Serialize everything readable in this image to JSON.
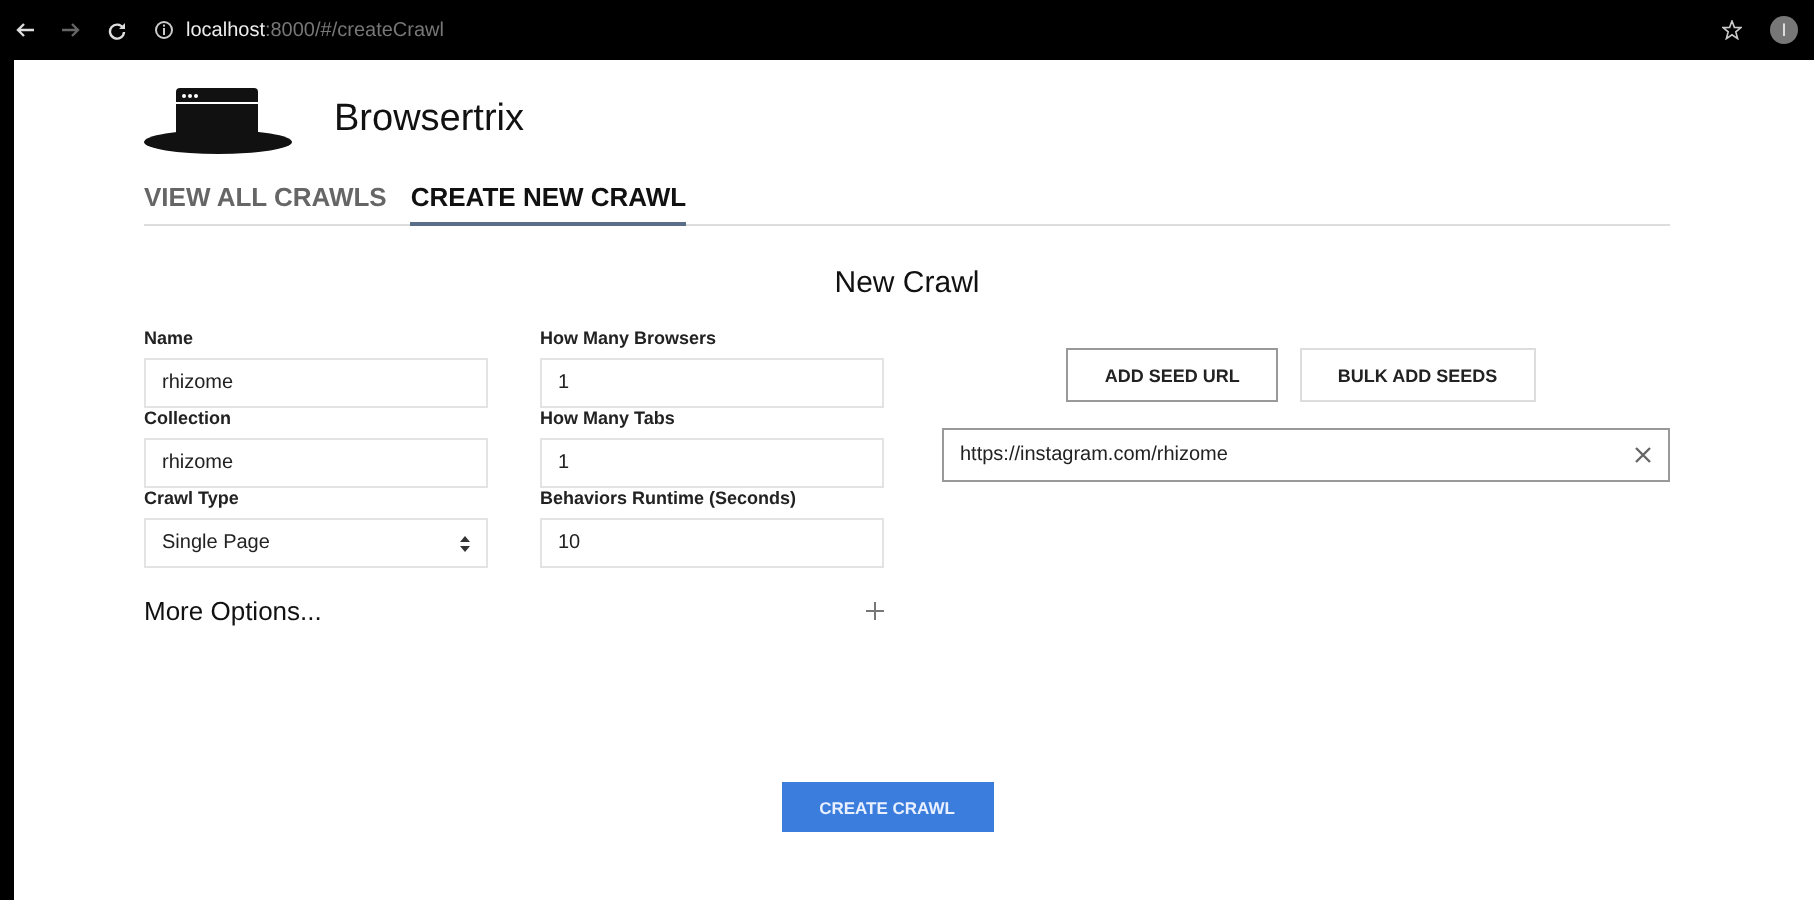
{
  "browser": {
    "url_host": "localhost",
    "url_path": ":8000/#/createCrawl",
    "avatar": "I"
  },
  "app": {
    "title": "Browsertrix"
  },
  "tabs": [
    {
      "label": "VIEW ALL CRAWLS",
      "selected": false
    },
    {
      "label": "CREATE NEW CRAWL",
      "selected": true
    }
  ],
  "form": {
    "title": "New Crawl",
    "fields": [
      {
        "label": "Name",
        "value": "rhizome",
        "kind": "text"
      },
      {
        "label": "How Many Browsers",
        "value": "1",
        "kind": "text"
      },
      {
        "label": "Collection",
        "value": "rhizome",
        "kind": "text"
      },
      {
        "label": "How Many Tabs",
        "value": "1",
        "kind": "text"
      },
      {
        "label": "Crawl Type",
        "value": "Single Page",
        "kind": "select"
      },
      {
        "label": "Behaviors Runtime (Seconds)",
        "value": "10",
        "kind": "text"
      }
    ],
    "more_options": {
      "label": "More Options...",
      "expanded": false
    },
    "seed_buttons": [
      "ADD SEED URL",
      "BULK ADD SEEDS"
    ],
    "seeds": [
      "https://instagram.com/rhizome"
    ],
    "submit": "CREATE CRAWL"
  }
}
